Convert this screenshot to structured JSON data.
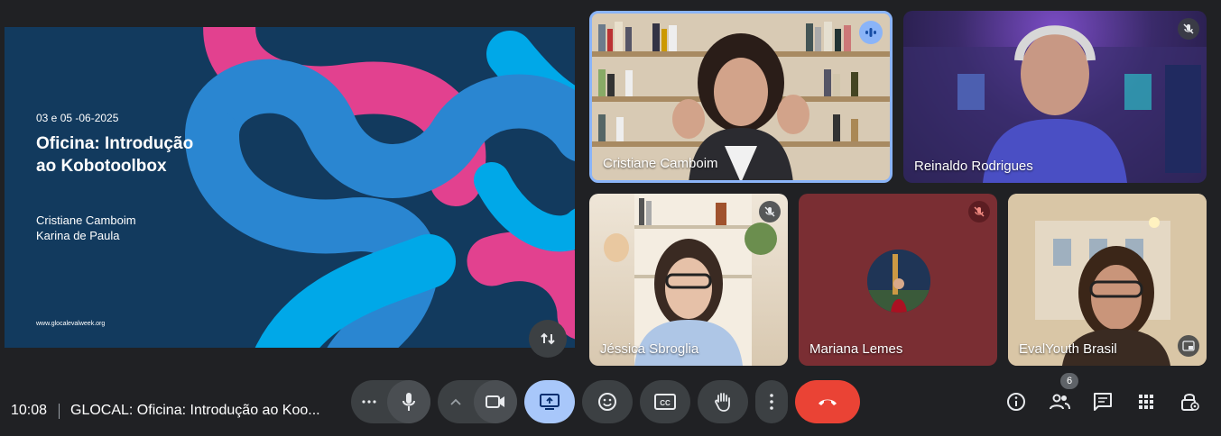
{
  "presentation": {
    "date": "03 e 05 -06-2025",
    "title": "Oficina: Introdução ao Kobotoolbox",
    "authors": [
      "Cristiane Camboim",
      "Karina de Paula"
    ],
    "website": "www.glocalevalweek.org"
  },
  "participants": [
    {
      "name": "Cristiane Camboim",
      "status": "speaking"
    },
    {
      "name": "Reinaldo Rodrigues",
      "status": "muted"
    },
    {
      "name": "Jéssica Sbroglia",
      "status": "muted"
    },
    {
      "name": "Mariana Lemes",
      "status": "muted"
    },
    {
      "name": "EvalYouth Brasil",
      "status": "pinned"
    }
  ],
  "bar": {
    "time": "10:08",
    "meeting_title": "GLOCAL: Oficina: Introdução ao Koo...",
    "people_count": "6"
  },
  "colors": {
    "background": "#202124",
    "button": "#3c4043",
    "active": "#8ab4f8",
    "end_call": "#ea4335",
    "slide_bg": "#123a5e",
    "slide_pink": "#e2418f",
    "slide_blue": "#2a86d1"
  },
  "icons": {
    "more": "more-horiz-icon",
    "mic": "mic-icon",
    "chevron": "chevron-up-icon",
    "camera": "videocam-icon",
    "present": "present-screen-icon",
    "emoji": "emoji-icon",
    "captions": "closed-captions-icon",
    "hand": "raise-hand-icon",
    "options": "more-vert-icon",
    "end": "call-end-icon",
    "info": "info-icon",
    "people": "people-icon",
    "chat": "chat-icon",
    "activities": "apps-grid-icon",
    "host": "host-controls-icon"
  }
}
